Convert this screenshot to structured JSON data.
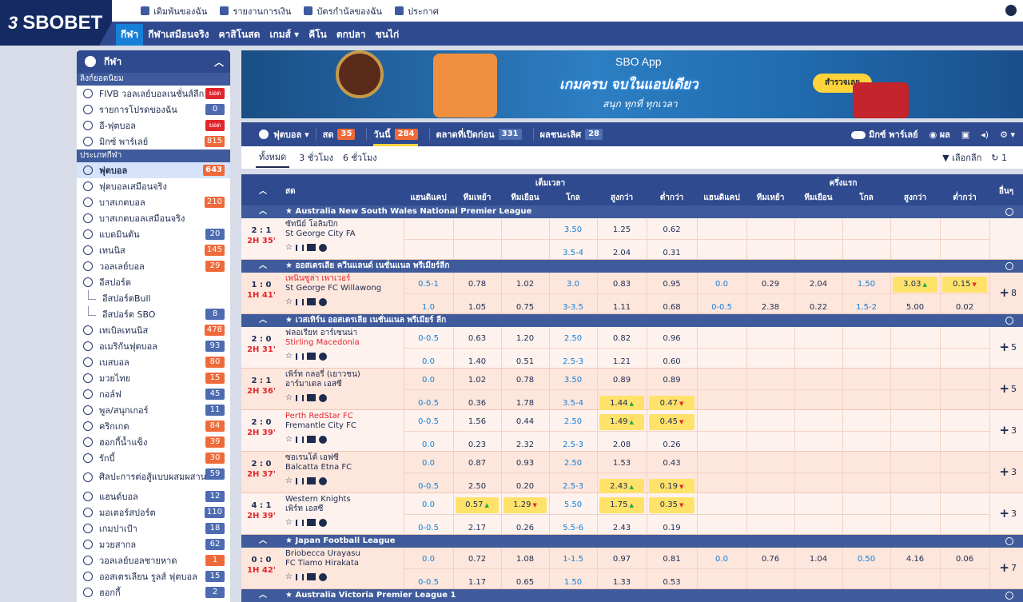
{
  "brand": {
    "name": "SBOBET",
    "mark": "3"
  },
  "toplinks": [
    "เดิมพันของฉัน",
    "รายงานการเงิน",
    "บัตรกำนัลของฉัน",
    "ประกาศ"
  ],
  "nav": [
    "กีฬา",
    "กีฬาเสมือนจริง",
    "คาสิโนสด",
    "เกมส์ ▾",
    "คีโน",
    "ตกปลา",
    "ชนไก่"
  ],
  "sidebar": {
    "header": "กีฬา",
    "popular_label": "ลิงก์ยอดนิยม",
    "popular": [
      {
        "label": "FIVB วอลเลย์บอลเนชั่นส์ลีก",
        "badge": "ยอด",
        "bt": "r"
      },
      {
        "label": "รายการโปรดของฉัน",
        "badge": "0",
        "bt": ""
      },
      {
        "label": "อี-ฟุตบอล",
        "badge": "ยอด",
        "bt": "r"
      },
      {
        "label": "มิกซ์ พาร์เลย์",
        "badge": "815",
        "bt": "o"
      }
    ],
    "types_label": "ประเภทกีฬา",
    "sports": [
      {
        "label": "ฟุตบอล",
        "badge": "643",
        "bt": "o",
        "sel": true
      },
      {
        "label": "ฟุตบอลเสมือนจริง",
        "badge": "",
        "bt": ""
      },
      {
        "label": "บาสเกตบอล",
        "badge": "210",
        "bt": "o"
      },
      {
        "label": "บาสเกตบอลเสมือนจริง",
        "badge": "",
        "bt": ""
      },
      {
        "label": "แบดมินตัน",
        "badge": "20",
        "bt": ""
      },
      {
        "label": "เทนนิส",
        "badge": "145",
        "bt": "o"
      },
      {
        "label": "วอลเลย์บอล",
        "badge": "29",
        "bt": "o"
      },
      {
        "label": "อีสปอร์ต",
        "badge": "",
        "bt": ""
      },
      {
        "label": "อีสปอร์ตBull",
        "badge": "",
        "bt": "",
        "ind": true
      },
      {
        "label": "อีสปอร์ต SBO",
        "badge": "8",
        "bt": "",
        "ind": true
      },
      {
        "label": "เทเบิลเทนนิส",
        "badge": "478",
        "bt": "o"
      },
      {
        "label": "อเมริกันฟุตบอล",
        "badge": "93",
        "bt": ""
      },
      {
        "label": "เบสบอล",
        "badge": "80",
        "bt": "o"
      },
      {
        "label": "มวยไทย",
        "badge": "15",
        "bt": "o"
      },
      {
        "label": "กอล์ฟ",
        "badge": "45",
        "bt": ""
      },
      {
        "label": "พูล/สนุกเกอร์",
        "badge": "11",
        "bt": ""
      },
      {
        "label": "คริกเกต",
        "badge": "84",
        "bt": "o"
      },
      {
        "label": "ฮอกกี้น้ำแข็ง",
        "badge": "39",
        "bt": "o"
      },
      {
        "label": "รักบี้",
        "badge": "30",
        "bt": "o"
      },
      {
        "label": "ศิลปะการต่อสู้แบบผสมผสาน",
        "badge": "59",
        "bt": "",
        "tall": true
      },
      {
        "label": "แฮนด์บอล",
        "badge": "12",
        "bt": ""
      },
      {
        "label": "มอเตอร์สปอร์ต",
        "badge": "110",
        "bt": ""
      },
      {
        "label": "เกมปาเป้า",
        "badge": "18",
        "bt": ""
      },
      {
        "label": "มวยสากล",
        "badge": "62",
        "bt": ""
      },
      {
        "label": "วอลเลย์บอลชายหาด",
        "badge": "1",
        "bt": "o"
      },
      {
        "label": "ออสเตรเลียน รูลส์ ฟุตบอล",
        "badge": "15",
        "bt": ""
      },
      {
        "label": "ฮอกกี้",
        "badge": "2",
        "bt": ""
      }
    ]
  },
  "banner": {
    "app": "SBO App",
    "headline": "เกมครบ จบในแอปเดียว",
    "sub": "สนุก ทุกที่ ทุกเวลา",
    "cta": "สำรวจเลย"
  },
  "toolbar": {
    "sport": "ฟุตบอล",
    "live": "สด",
    "live_n": "35",
    "today": "วันนี้",
    "today_n": "284",
    "early": "ตลาดที่เปิดก่อน",
    "early_n": "331",
    "results": "ผลชนะเลิศ",
    "results_n": "28",
    "mix": "มิกซ์ พาร์เลย์",
    "res": "ผล"
  },
  "filters": {
    "all": "ทั้งหมด",
    "h3": "3 ชั่วโมง",
    "h6": "6 ชั่วโมง",
    "select": "เลือกลีก",
    "count": "1"
  },
  "table": {
    "live": "สด",
    "full": "เต็มเวลา",
    "half": "ครึ่งแรก",
    "more": "อื่นๆ",
    "cols": [
      "แฮนดิแคป",
      "ทีมเหย้า",
      "ทีมเยือน",
      "โกล",
      "สูงกว่า",
      "ต่ำกว่า"
    ]
  },
  "rows": [
    {
      "league": "Australia New South Wales National Premier League"
    },
    {
      "score": "2 : 1",
      "time": "2H 35'",
      "home": "ซัทนีย์ โอลิมปิก",
      "away": "St George City FA",
      "hr": false,
      "ar": false,
      "bg": "alt2",
      "more": "",
      "l1": [
        "",
        "",
        "",
        "3.50",
        "1.25",
        "0.62",
        "",
        "",
        "",
        "",
        "",
        ""
      ],
      "l2": [
        "",
        "",
        "",
        "3.5-4",
        "2.04",
        "0.31",
        "",
        "",
        "",
        "",
        "",
        ""
      ]
    },
    {
      "league": "ออสเตรเลีย ควีนแลนด์ เนชั่นแนล พรีเมียร์ลีก"
    },
    {
      "score": "1 : 0",
      "time": "1H 41'",
      "home": "เพนินซูล่า เพาเวอร์",
      "away": "St George FC Willawong",
      "hr": true,
      "ar": false,
      "bg": "alt",
      "more": "8",
      "l1": [
        "0.5-1",
        "0.78",
        "1.02",
        "3.0",
        "0.83",
        "0.95",
        "0.0",
        "0.29",
        "2.04",
        "1.50",
        "3.03▲",
        "0.15▼"
      ],
      "l2": [
        "1.0",
        "1.05",
        "0.75",
        "3-3.5",
        "1.11",
        "0.68",
        "0-0.5",
        "2.38",
        "0.22",
        "1.5-2",
        "5.00",
        "0.02"
      ]
    },
    {
      "league": "เวสเทิร์น ออสเตรเลีย เนชั่นแนล พรีเมียร์ ลีก"
    },
    {
      "score": "2 : 0",
      "time": "2H 31'",
      "home": "ฟลอเรียท อาร์เซนน่า",
      "away": "Stirling Macedonia",
      "hr": false,
      "ar": true,
      "bg": "alt2",
      "more": "5",
      "l1": [
        "0-0.5",
        "0.63",
        "1.20",
        "2.50",
        "0.82",
        "0.96",
        "",
        "",
        "",
        "",
        "",
        ""
      ],
      "l2": [
        "0.0",
        "1.40",
        "0.51",
        "2.5-3",
        "1.21",
        "0.60",
        "",
        "",
        "",
        "",
        "",
        ""
      ]
    },
    {
      "score": "2 : 1",
      "time": "2H 36'",
      "home": "เพิร์ท กลอรี่ (เยาวชน)",
      "away": "อาร์มาเดล เอสซี",
      "hr": false,
      "ar": false,
      "bg": "alt",
      "more": "5",
      "l1": [
        "0.0",
        "1.02",
        "0.78",
        "3.50",
        "0.89",
        "0.89",
        "",
        "",
        "",
        "",
        "",
        ""
      ],
      "l2": [
        "0-0.5",
        "0.36",
        "1.78",
        "3.5-4",
        "1.44▲",
        "0.47▼",
        "",
        "",
        "",
        "",
        "",
        ""
      ]
    },
    {
      "score": "2 : 0",
      "time": "2H 39'",
      "home": "Perth RedStar FC",
      "away": "Fremantle City FC",
      "hr": true,
      "ar": false,
      "bg": "alt2",
      "more": "3",
      "l1": [
        "0-0.5",
        "1.56",
        "0.44",
        "2.50",
        "1.49▲",
        "0.45▼",
        "",
        "",
        "",
        "",
        "",
        ""
      ],
      "l2": [
        "0.0",
        "0.23",
        "2.32",
        "2.5-3",
        "2.08",
        "0.26",
        "",
        "",
        "",
        "",
        "",
        ""
      ]
    },
    {
      "score": "2 : 0",
      "time": "2H 37'",
      "home": "ซอเรนโต้ เอฟซี",
      "away": "Balcatta Etna FC",
      "hr": false,
      "ar": false,
      "bg": "alt",
      "more": "3",
      "l1": [
        "0.0",
        "0.87",
        "0.93",
        "2.50",
        "1.53",
        "0.43",
        "",
        "",
        "",
        "",
        "",
        ""
      ],
      "l2": [
        "0-0.5",
        "2.50",
        "0.20",
        "2.5-3",
        "2.43▲",
        "0.19▼",
        "",
        "",
        "",
        "",
        "",
        ""
      ]
    },
    {
      "score": "4 : 1",
      "time": "2H 39'",
      "home": "Western Knights",
      "away": "เพิร์ท เอสซี",
      "hr": false,
      "ar": false,
      "bg": "alt2",
      "more": "3",
      "l1": [
        "0.0",
        "0.57▲",
        "1.29▼",
        "5.50",
        "1.75▲",
        "0.35▼",
        "",
        "",
        "",
        "",
        "",
        ""
      ],
      "l2": [
        "0-0.5",
        "2.17",
        "0.26",
        "5.5-6",
        "2.43",
        "0.19",
        "",
        "",
        "",
        "",
        "",
        ""
      ]
    },
    {
      "league": "Japan Football League"
    },
    {
      "score": "0 : 0",
      "time": "1H 42'",
      "home": "Briobecca Urayasu",
      "away": "FC Tiamo Hirakata",
      "hr": false,
      "ar": false,
      "bg": "alt",
      "more": "7",
      "l1": [
        "0.0",
        "0.72",
        "1.08",
        "1-1.5",
        "0.97",
        "0.81",
        "0.0",
        "0.76",
        "1.04",
        "0.50",
        "4.16",
        "0.06"
      ],
      "l2": [
        "0-0.5",
        "1.17",
        "0.65",
        "1.50",
        "1.33",
        "0.53",
        "",
        "",
        "",
        "",
        "",
        ""
      ]
    },
    {
      "league": "Australia Victoria Premier League 1"
    }
  ]
}
